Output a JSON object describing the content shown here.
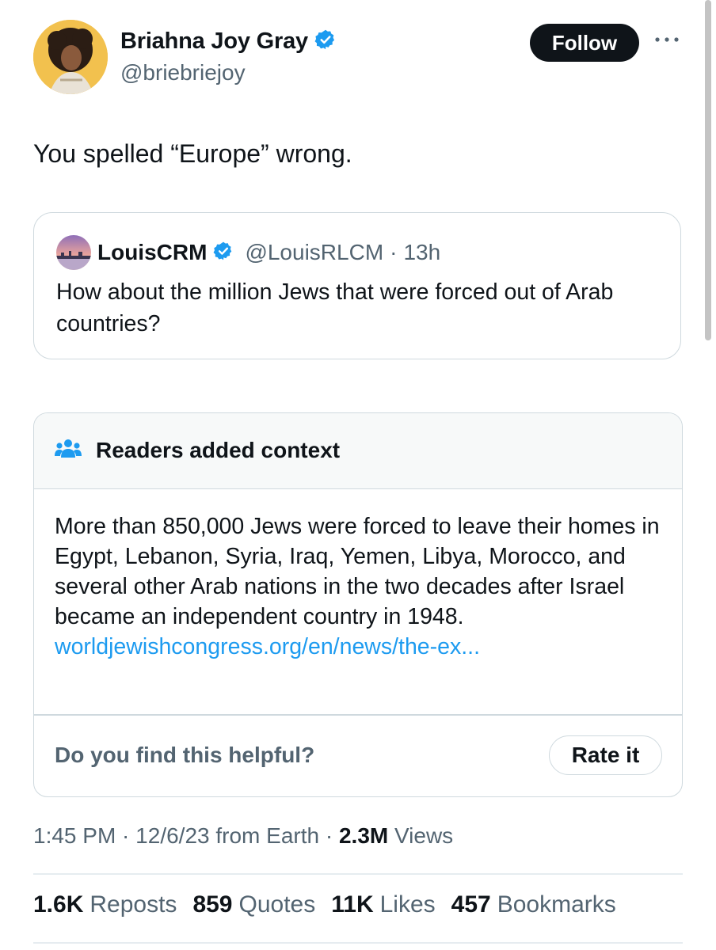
{
  "author": {
    "name": "Briahna Joy Gray",
    "handle": "@briebriejoy",
    "verified_icon": "verified-badge-icon"
  },
  "follow_label": "Follow",
  "more_icon": "more-horizontal-icon",
  "tweet_text": "You spelled “Europe” wrong.",
  "quote": {
    "name": "LouisCRM",
    "handle": "@LouisRLCM",
    "separator": "·",
    "time": "13h",
    "text": "How about the million Jews that were forced out of Arab countries?"
  },
  "note": {
    "icon": "people-group-icon",
    "title": "Readers added context",
    "body": "More than 850,000 Jews were forced to leave their homes in Egypt, Lebanon, Syria, Iraq, Yemen, Libya, Morocco, and several other Arab nations in the two decades after Israel became an independent country in 1948.",
    "link": "worldjewishcongress.org/en/news/the-ex...",
    "helpful_prompt": "Do you find this helpful?",
    "rate_label": "Rate it"
  },
  "meta": {
    "time": "1:45 PM",
    "date": "12/6/23",
    "from": "from Earth",
    "views_count": "2.3M",
    "views_label": "Views",
    "sep": " · "
  },
  "stats": [
    {
      "value": "1.6K",
      "label": "Reposts"
    },
    {
      "value": "859",
      "label": "Quotes"
    },
    {
      "value": "11K",
      "label": "Likes"
    },
    {
      "value": "457",
      "label": "Bookmarks"
    }
  ],
  "colors": {
    "accent": "#1d9bf0",
    "text": "#0f1419",
    "secondary": "#536471",
    "border": "#cfd9de"
  }
}
